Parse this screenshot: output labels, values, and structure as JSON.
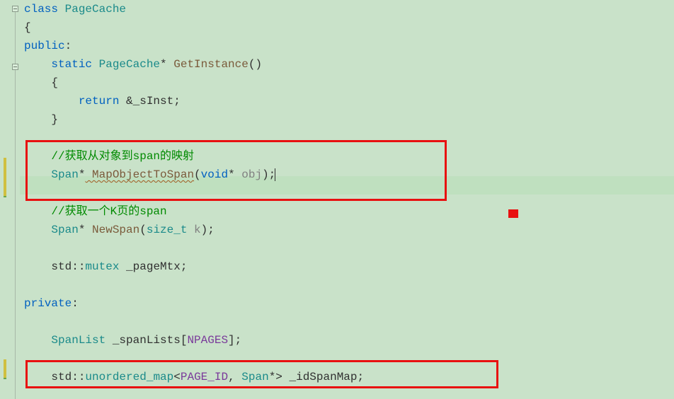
{
  "lines": {
    "l1_kw": "class",
    "l1_type": " PageCache",
    "l2": "{",
    "l3_kw": "public",
    "l3_punct": ":",
    "l4_kw": "    static",
    "l4_type": " PageCache",
    "l4_punct1": "*",
    "l4_func": " GetInstance",
    "l4_punct2": "()",
    "l5": "    {",
    "l6_kw": "        return",
    "l6_rest": " &_sInst;",
    "l7": "    }",
    "l8_comment": "    //获取从对象到span的映射",
    "l9_type": "    Span",
    "l9_punct1": "*",
    "l9_func": " MapObjectToSpan",
    "l9_punct2": "(",
    "l9_kw": "void",
    "l9_punct3": "*",
    "l9_gray": " obj",
    "l9_punct4": ");",
    "l10_comment": "    //获取一个K页的span",
    "l11_type": "    Span",
    "l11_punct1": "*",
    "l11_func": " NewSpan",
    "l11_punct2": "(",
    "l11_type2": "size_t",
    "l11_gray": " k",
    "l11_punct3": ");",
    "l12_pre": "    std::",
    "l12_type": "mutex",
    "l12_ident": " _pageMtx;",
    "l13_kw": "private",
    "l13_punct": ":",
    "l14_type": "    SpanList",
    "l14_ident": " _spanLists[",
    "l14_macro": "NPAGES",
    "l14_punct": "];",
    "l15_pre": "    std::",
    "l15_type": "unordered_map",
    "l15_punct1": "<",
    "l15_macro": "PAGE_ID",
    "l15_punct2": ", ",
    "l15_type2": "Span",
    "l15_punct3": "*> _idSpanMap;"
  }
}
